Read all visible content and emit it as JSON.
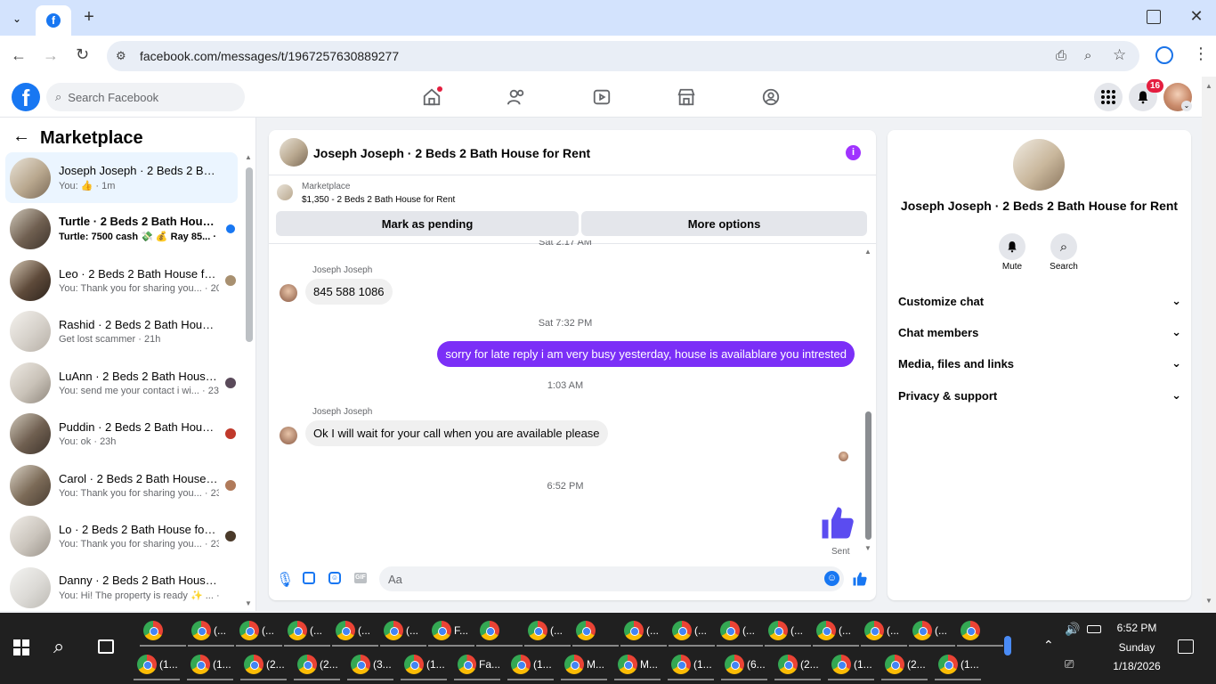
{
  "browser": {
    "url": "facebook.com/messages/t/1967257630889277"
  },
  "header": {
    "search_placeholder": "Search Facebook",
    "notification_count": "16"
  },
  "sidebar": {
    "title": "Marketplace",
    "conversations": [
      {
        "name": "Joseph Joseph · 2 Beds 2 Bath ...",
        "sub": "You: 👍 · 1m"
      },
      {
        "name": "Turtle · 2 Beds 2 Bath House f...",
        "sub": "Turtle: 7500 cash 💸 💰 Ray 85... · 2h"
      },
      {
        "name": "Leo · 2 Beds 2 Bath House for...",
        "sub": "You: Thank you for sharing you... · 20h"
      },
      {
        "name": "Rashid · 2 Beds 2 Bath House fo...",
        "sub": "Get lost scammer · 21h"
      },
      {
        "name": "LuAnn · 2 Beds 2 Bath House ...",
        "sub": "You: send me your contact i wi... · 23h"
      },
      {
        "name": "Puddin · 2 Beds 2 Bath House...",
        "sub": "You: ok · 23h"
      },
      {
        "name": "Carol · 2 Beds 2 Bath House f...",
        "sub": "You: Thank you for sharing you... · 23h"
      },
      {
        "name": "Lo · 2 Beds 2 Bath House for ...",
        "sub": "You: Thank you for sharing you... · 23h"
      },
      {
        "name": "Danny · 2 Beds 2 Bath House fo...",
        "sub": "You: Hi! The property is ready ✨ ... · 23h"
      }
    ]
  },
  "chat": {
    "title": "Joseph Joseph · 2 Beds 2 Bath House for Rent",
    "listing_label": "Marketplace",
    "listing_price": "$1,350 - 2 Beds 2 Bath House for Rent",
    "mark_pending": "Mark as pending",
    "more_options": "More options",
    "top_time": "Sat 2:17 AM",
    "sender1": "Joseph Joseph",
    "msg1": "845 588 1086",
    "time2": "Sat 7:32 PM",
    "msg_out": "sorry for late reply i am very busy yesterday, house is availablare you intrested",
    "time3": "1:03 AM",
    "sender2": "Joseph Joseph",
    "msg2": "Ok I will wait for your call when you are available please",
    "time4": "6:52 PM",
    "sent_label": "Sent",
    "composer_placeholder": "Aa"
  },
  "right_panel": {
    "title": "Joseph Joseph · 2 Beds 2 Bath House for Rent",
    "mute": "Mute",
    "search": "Search",
    "sections": [
      "Customize chat",
      "Chat members",
      "Media, files and links",
      "Privacy & support"
    ]
  },
  "taskbar": {
    "row1": [
      "",
      "(...",
      "(...",
      "(...",
      "(...",
      "(...",
      "F...",
      "",
      "(...",
      "",
      "(...",
      "(...",
      "(...",
      "(...",
      "(...",
      "(...",
      "(...",
      ""
    ],
    "row2": [
      "(1...",
      "(1...",
      "(2...",
      "(2...",
      "(3...",
      "(1...",
      "Fa...",
      "(1...",
      "M...",
      "M...",
      "(1...",
      "(6...",
      "(2...",
      "(1...",
      "(2...",
      "(1..."
    ],
    "time": "6:52 PM",
    "day": "Sunday",
    "date": "1/18/2026"
  },
  "colors": {
    "brand": "#1877f2",
    "outgoing": "#7b2ff7",
    "like": "#5b4cf0"
  }
}
